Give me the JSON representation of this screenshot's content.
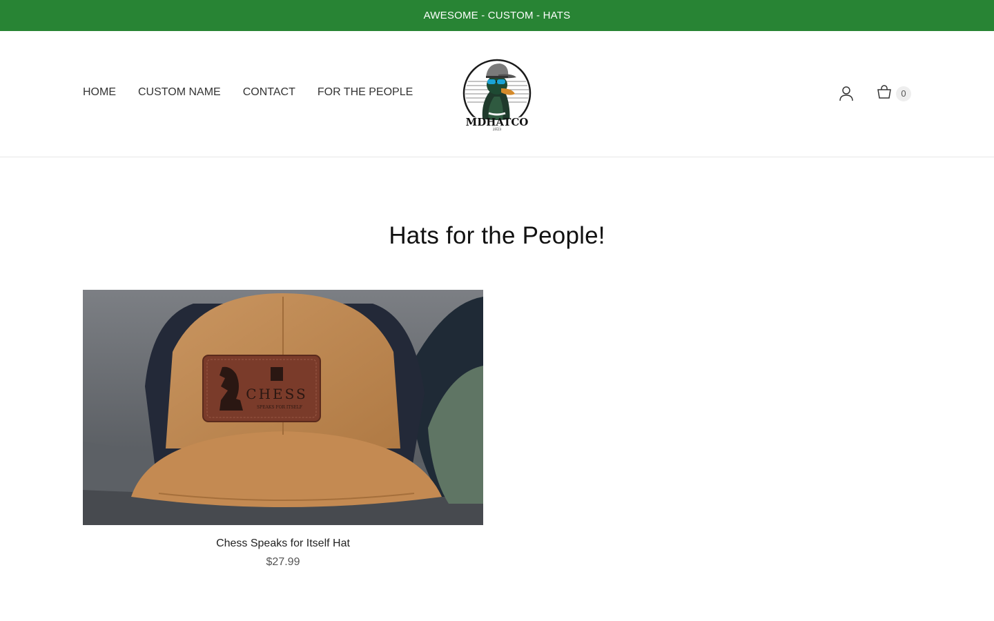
{
  "announcement": {
    "text": "AWESOME - CUSTOM - HATS",
    "background_color": "#288434"
  },
  "header": {
    "nav_items": [
      "HOME",
      "CUSTOM NAME",
      "CONTACT",
      "FOR THE PEOPLE"
    ],
    "logo": {
      "name": "MDHATCO",
      "year": "2023",
      "icon": "duck-with-cap-logo"
    },
    "account_icon": "user-icon",
    "cart": {
      "icon": "shopping-bag-icon",
      "count": "0"
    }
  },
  "main": {
    "title": "Hats for the People!",
    "products": [
      {
        "name": "Chess Speaks for Itself Hat",
        "price": "$27.99",
        "patch_text": "CHESS",
        "patch_subtext": "SPEAKS FOR ITSELF"
      }
    ]
  }
}
